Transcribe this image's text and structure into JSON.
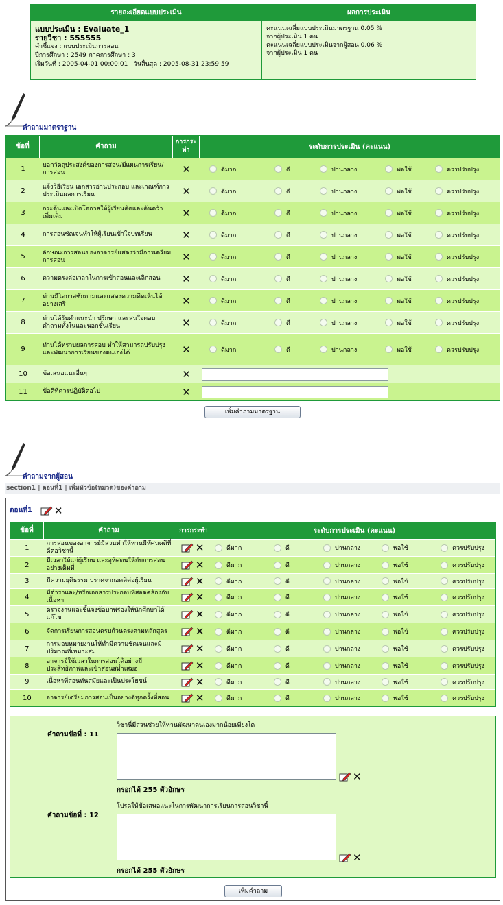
{
  "summary": {
    "header_left": "รายละเอียดแบบประเมิน",
    "header_right": "ผลการประเมิน",
    "form_line": "แบบประเมิน : Evaluate_1",
    "course_line": "รายวิชา : 555555",
    "desc_line": "คำชี้แจง : แบบประเมินการสอน",
    "year_line": "ปีการศึกษา : 2549 ภาคการศึกษา : 3",
    "date_line": "เริ่มวันที่ : 2005-04-01 00:00:01   วันสิ้นสุด : 2005-08-31 23:59:59",
    "result_1": "คะแนนเฉลี่ยแบบประเมินมาตรฐาน 0.05 %",
    "result_2": "จากผู้ประเมิน 1 คน",
    "result_3": "คะแนนเฉลี่ยแบบประเมินจากผู้สอน 0.06 %",
    "result_4": "จากผู้ประเมิน 1 คน"
  },
  "standard": {
    "title": "คำถามมาตราฐาน",
    "col_no": "ข้อที่",
    "col_question": "คำถาม",
    "col_action": "การกระทำ",
    "col_level": "ระดับการประเมิน (คะแนน)",
    "levels": [
      "ดีมาก",
      "ดี",
      "ปานกลาง",
      "พอใช้",
      "ควรปรับปรุง"
    ],
    "rows": [
      {
        "no": "1",
        "q": "บอกวัตถุประสงค์ของการสอน/มีแผนการเรียน/การสอน"
      },
      {
        "no": "2",
        "q": "แจ้งวิธีเรียน เอกสารอ่านประกอบ และเกณฑ์การประเมินผลการเรียน"
      },
      {
        "no": "3",
        "q": "กระตุ้นและเปิดโอกาสให้ผู้เรียนคิดและค้นคว้าเพิ่มเติม"
      },
      {
        "no": "4",
        "q": "การสอนชัดเจนทำให้ผู้เรียนเข้าใจบทเรียน"
      },
      {
        "no": "5",
        "q": "ลักษณะการสอนของอาจารย์แสดงว่ามีการเตรียมการสอน"
      },
      {
        "no": "6",
        "q": "ความตรงต่อเวลาในการเข้าสอนและเลิกสอน"
      },
      {
        "no": "7",
        "q": "ท่านมีโอกาสซักถามและแสดงความคิดเห็นได้อย่างเสรี"
      },
      {
        "no": "8",
        "q": "ท่านได้รับคำแนะนำ ปรึกษา และสนใจตอบคำถามทั้งในและนอกชั้นเรียน"
      },
      {
        "no": "9",
        "q": "ท่านได้ทราบผลการสอบ ทำให้สามารถปรับปรุงและพัฒนาการเรียนของตนเองได้"
      }
    ],
    "text_rows": [
      {
        "no": "10",
        "q": "ข้อเสนอแนะอื่นๆ",
        "value": ""
      },
      {
        "no": "11",
        "q": "ข้อดีที่ควรปฏิบัติต่อไป",
        "value": ""
      }
    ],
    "add_button": "เพิ่มคำถามมาตรฐาน"
  },
  "teacher": {
    "title": "คำถามจากผู้สอน",
    "crumb_1": "section1",
    "crumb_sep": "|",
    "crumb_2": "ตอนที่1",
    "crumb_3": "เพิ่มหัวข้อ(หมวด)ของคำถาม",
    "part_label": "ตอนที่1",
    "col_no": "ข้อที่",
    "col_question": "คำถาม",
    "col_action": "การกระทำ",
    "col_level": "ระดับการประเมิน (คะแนน)",
    "levels": [
      "ดีมาก",
      "ดี",
      "ปานกลาง",
      "พอใช้",
      "ควรปรับปรุง"
    ],
    "rows": [
      {
        "no": "1",
        "q": "การสอนของอาจารย์มีส่วนทำให้ท่านมีทัศนคติที่ดีต่อวิชานี้"
      },
      {
        "no": "2",
        "q": "มีเวลาให้แก่ผู้เรียน และอุทิศตนให้กับการสอนอย่างเต็มที่"
      },
      {
        "no": "3",
        "q": "มีความยุติธรรม ปราศจากอคติต่อผู้เรียน"
      },
      {
        "no": "4",
        "q": "มีตำราและ/หรือเอกสารประกอบที่สอดคล้องกับเนื้อหา"
      },
      {
        "no": "5",
        "q": "ตรวจงานและชี้แจงข้อบกพร่องให้นักศึกษาได้แก้ไข"
      },
      {
        "no": "6",
        "q": "จัดการเรียนการสอนครบถ้วนตรงตามหลักสูตร"
      },
      {
        "no": "7",
        "q": "การมอบหมายงานให้ทำมีความชัดเจนและมีปริมาณที่เหมาะสม"
      },
      {
        "no": "8",
        "q": "อาจารย์ใช้เวลาในการสอนได้อย่างมีประสิทธิภาพและเข้าสอนสม่ำเสมอ"
      },
      {
        "no": "9",
        "q": "เนื้อหาที่สอนทันสมัยและเป็นประโยชน์"
      },
      {
        "no": "10",
        "q": "อาจารย์เตรียมการสอนเป็นอย่างดีทุกครั้งที่สอน"
      }
    ],
    "open_q": [
      {
        "label": "คำถามข้อที่ : 11",
        "text": "วิชานี้มีส่วนช่วยให้ท่านพัฒนาตนเองมากน้อยเพียงใด",
        "limit": "กรอกได้ 255 ตัวอักษร",
        "value": ""
      },
      {
        "label": "คำถามข้อที่ : 12",
        "text": "โปรดให้ข้อเสนอแนะในการพัฒนาการเรียนการสอนวิชานี้",
        "limit": "กรอกได้ 255 ตัวอักษร",
        "value": ""
      }
    ],
    "add_button": "เพิ่มคำถาม"
  },
  "icons": {
    "pen": "pen-icon",
    "edit": "edit-pencil-icon",
    "delete": "delete-x-icon"
  },
  "colors": {
    "header": "#1f9a3a",
    "row_light": "#e0f9c4",
    "row_dark": "#c9f38f",
    "title": "#1a2a8a"
  }
}
